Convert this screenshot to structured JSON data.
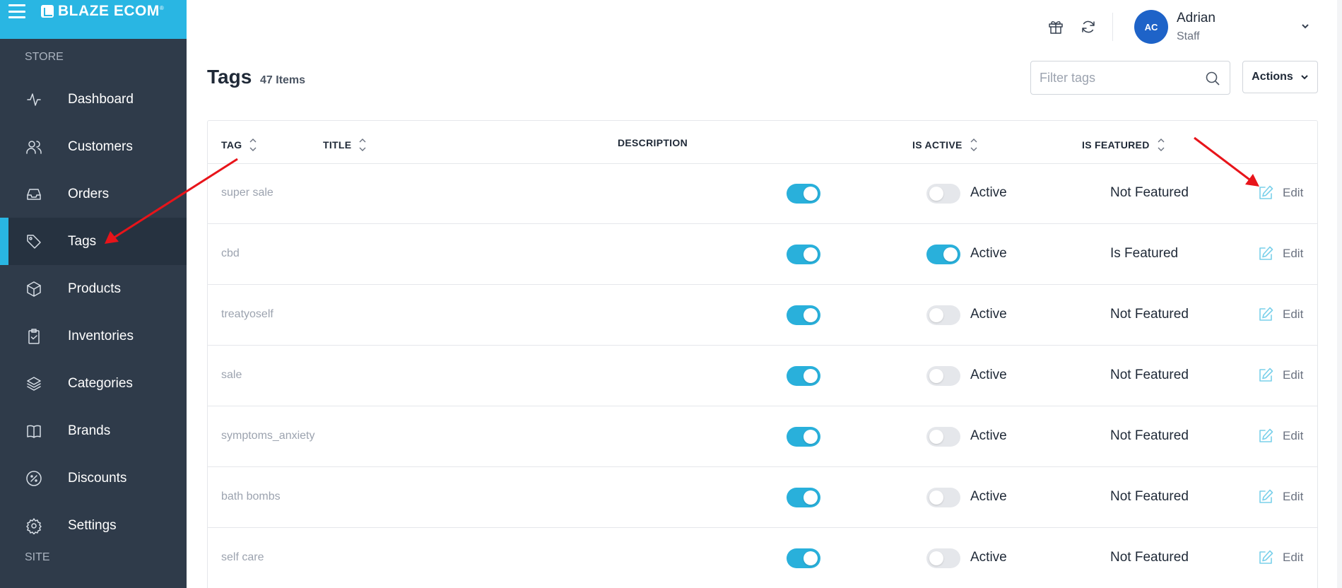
{
  "brand": {
    "name": "BLAZE ECOM",
    "mark": "®"
  },
  "sidebar": {
    "section_store": "STORE",
    "section_site": "SITE",
    "items": [
      {
        "label": "Dashboard",
        "icon": "activity-icon",
        "active": false
      },
      {
        "label": "Customers",
        "icon": "users-icon",
        "active": false
      },
      {
        "label": "Orders",
        "icon": "inbox-icon",
        "active": false
      },
      {
        "label": "Tags",
        "icon": "tag-icon",
        "active": true
      },
      {
        "label": "Products",
        "icon": "box-icon",
        "active": false
      },
      {
        "label": "Inventories",
        "icon": "clipboard-icon",
        "active": false
      },
      {
        "label": "Categories",
        "icon": "layers-icon",
        "active": false
      },
      {
        "label": "Brands",
        "icon": "book-icon",
        "active": false
      },
      {
        "label": "Discounts",
        "icon": "percent-icon",
        "active": false
      },
      {
        "label": "Settings",
        "icon": "gear-icon",
        "active": false
      }
    ]
  },
  "header": {
    "user": {
      "initials": "AC",
      "name": "Adrian",
      "role": "Staff"
    }
  },
  "page": {
    "title": "Tags",
    "count": "47 Items",
    "filter_placeholder": "Filter tags",
    "actions_label": "Actions"
  },
  "table": {
    "columns": [
      "TAG",
      "TITLE",
      "DESCRIPTION",
      "IS ACTIVE",
      "IS FEATURED"
    ],
    "rows": [
      {
        "tag": "super sale",
        "active": true,
        "active_label": "Active",
        "featured": false,
        "featured_label": "Not Featured",
        "edit": "Edit"
      },
      {
        "tag": "cbd",
        "active": true,
        "active_label": "Active",
        "featured": true,
        "featured_label": "Is Featured",
        "edit": "Edit"
      },
      {
        "tag": "treatyoself",
        "active": true,
        "active_label": "Active",
        "featured": false,
        "featured_label": "Not Featured",
        "edit": "Edit"
      },
      {
        "tag": "sale",
        "active": true,
        "active_label": "Active",
        "featured": false,
        "featured_label": "Not Featured",
        "edit": "Edit"
      },
      {
        "tag": "symptoms_anxiety",
        "active": true,
        "active_label": "Active",
        "featured": false,
        "featured_label": "Not Featured",
        "edit": "Edit"
      },
      {
        "tag": "bath bombs",
        "active": true,
        "active_label": "Active",
        "featured": false,
        "featured_label": "Not Featured",
        "edit": "Edit"
      },
      {
        "tag": "self care",
        "active": true,
        "active_label": "Active",
        "featured": false,
        "featured_label": "Not Featured",
        "edit": "Edit"
      }
    ]
  },
  "colors": {
    "accent": "#29b6e3",
    "sidebar_bg": "#2f3b4a",
    "toggle_on": "#29b0db",
    "avatar": "#1e63c8",
    "annotation_arrow": "#e8141a"
  }
}
